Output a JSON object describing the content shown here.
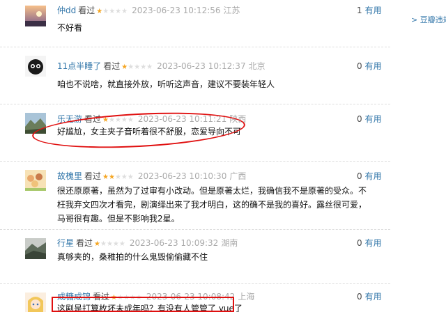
{
  "sidebar": {
    "link": "> 豆瓣违规"
  },
  "reviews": [
    {
      "user": "仲dd",
      "action": "看过",
      "rating": 1,
      "time": "2023-06-23 10:12:56",
      "location": "江苏",
      "useful_count": "1",
      "useful_label": "有用",
      "text": "不好看",
      "avatar": "sunset-sky-avatar"
    },
    {
      "user": "11点半睡了",
      "action": "看过",
      "rating": 1,
      "time": "2023-06-23 10:12:37",
      "location": "北京",
      "useful_count": "0",
      "useful_label": "有用",
      "text": "咱也不说啥，就直接外放，听听这声音，建议不要装年轻人",
      "avatar": "black-fluffball-avatar"
    },
    {
      "user": "乐无游",
      "action": "看过",
      "rating": 1,
      "time": "2023-06-23 10:11:21",
      "location": "陕西",
      "useful_count": "0",
      "useful_label": "有用",
      "text": "好尴尬，女主夹子音听着很不舒服，恋爱导向不可",
      "avatar": "landscape-avatar"
    },
    {
      "user": "故槐里",
      "action": "看过",
      "rating": 2,
      "time": "2023-06-23 10:10:30",
      "location": "广西",
      "useful_count": "0",
      "useful_label": "有用",
      "text": "很还原原著，虽然为了过审有小改动。但是原著太烂，我确信我不是原著的受众。不枉我弃文四次才看完，剧演绎出来了我才明白，这的确不是我的喜好。露丝很可爱，马哥很有趣。但是不影响我2星。",
      "avatar": "anime-group-avatar"
    },
    {
      "user": "行星",
      "action": "看过",
      "rating": 1,
      "time": "2023-06-23 10:09:32",
      "location": "湖南",
      "useful_count": "0",
      "useful_label": "有用",
      "text": "真够夹的，桑稚拍的什么鬼毁偷偷藏不住",
      "avatar": "misty-mountain-avatar"
    },
    {
      "user": "成糖成锦",
      "action": "看过",
      "rating": 1,
      "time": "2023-06-23 10:08:42",
      "location": "上海",
      "useful_count": "0",
      "useful_label": "有用",
      "text": "这剧是打算枚坏未成年吗？有没有人管管了 yue了",
      "avatar": "anime-girl-avatar"
    }
  ],
  "colors": {
    "link": "#3377aa",
    "star": "#f5a623",
    "annotation": "#e01010"
  }
}
